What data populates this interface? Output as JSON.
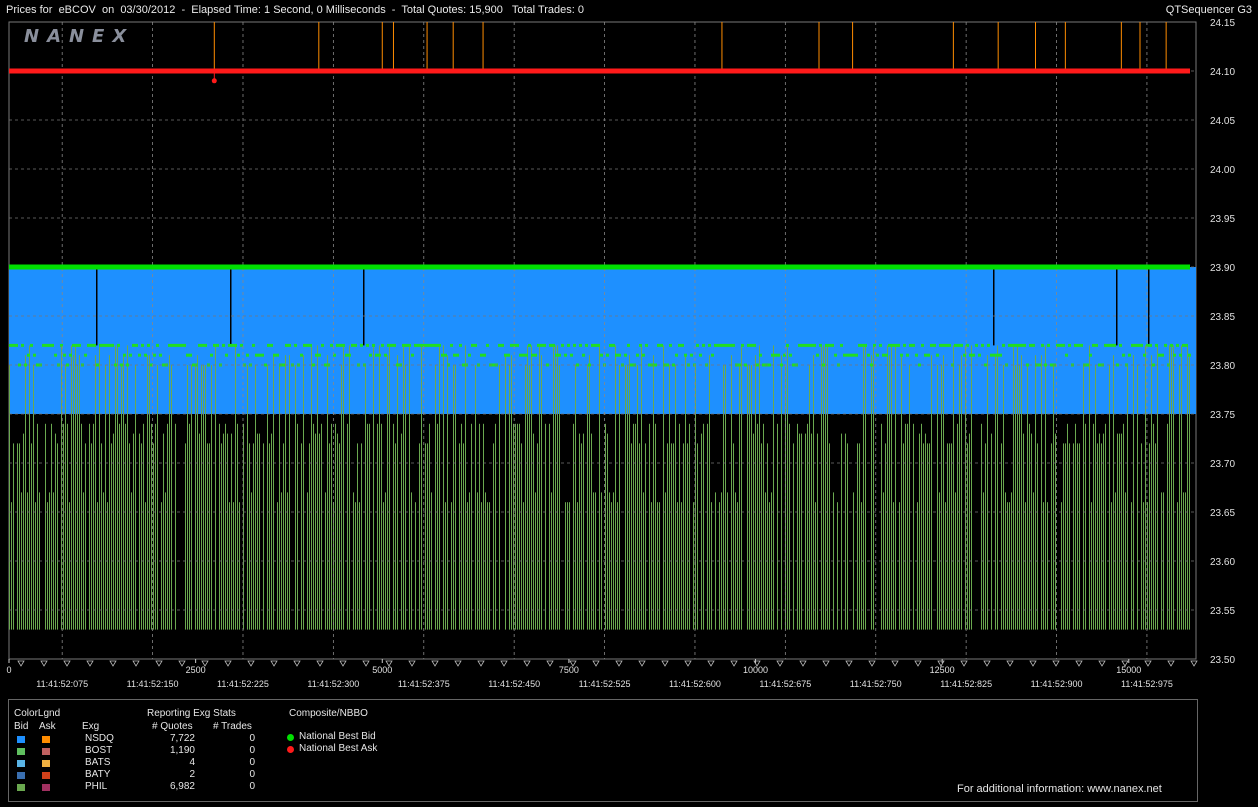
{
  "header": {
    "left_text": "Prices for  eBCOV  on  03/30/2012  -  Elapsed Time: 1 Second, 0 Milliseconds  -  Total Quotes: 15,900   Total Trades: 0",
    "right_text": "QTSequencer G3"
  },
  "logo_text": "NANEX",
  "chart_data": {
    "type": "line",
    "title": "",
    "ylim": [
      23.5,
      24.15
    ],
    "y_ticks": [
      "24.15",
      "24.10",
      "24.05",
      "24.00",
      "23.95",
      "23.90",
      "23.85",
      "23.80",
      "23.75",
      "23.70",
      "23.65",
      "23.60",
      "23.55",
      "23.50"
    ],
    "x_ticks_sequence": [
      {
        "label": "0",
        "x": 0
      },
      {
        "label": "2500",
        "x": 2500
      },
      {
        "label": "5000",
        "x": 5000
      },
      {
        "label": "7500",
        "x": 7500
      },
      {
        "label": "10000",
        "x": 10000
      },
      {
        "label": "12500",
        "x": 12500
      },
      {
        "label": "15000",
        "x": 15000
      }
    ],
    "x_ticks_time": [
      "11:41:52:075",
      "11:41:52:150",
      "11:41:52:225",
      "11:41:52:300",
      "11:41:52:375",
      "11:41:52:450",
      "11:41:52:525",
      "11:41:52:600",
      "11:41:52:675",
      "11:41:52:750",
      "11:41:52:825",
      "11:41:52:900",
      "11:41:52:975"
    ],
    "xlim": [
      0,
      15900
    ],
    "grid": true,
    "series": [
      {
        "name": "National Best Bid",
        "color": "#00e000",
        "values_description_price": 23.9
      },
      {
        "name": "National Best Ask",
        "color": "#ff1a1a",
        "values_description_price": 24.1
      }
    ],
    "nbb_price": 23.9,
    "nbo_price": 24.1,
    "nsdq_bid_top": 23.9,
    "nsdq_bid_bottom": 23.75,
    "phil_bid_level_high": 23.82,
    "phil_bid_level_low": 23.53,
    "ask_spike_positions": [
      2750,
      4150,
      5000,
      5150,
      5600,
      5950,
      6350,
      9550,
      10850,
      11300,
      12650,
      13250,
      13750,
      14150,
      14900,
      15150,
      15500
    ],
    "nbo_dip_point": {
      "x": 2750,
      "y": 24.09
    }
  },
  "legend": {
    "color_legend_title": "ColorLgnd",
    "reporting_title": "Reporting Exg Stats",
    "composite_title": "Composite/NBBO",
    "col_bid": "Bid",
    "col_ask": "Ask",
    "col_exg": "Exg",
    "col_quotes": "# Quotes",
    "col_trades": "# Trades",
    "rows": [
      {
        "exg": "NSDQ",
        "quotes": "7,722",
        "trades": "0",
        "bid_color": "#1e90ff",
        "ask_color": "#ff8c00"
      },
      {
        "exg": "BOST",
        "quotes": "1,190",
        "trades": "0",
        "bid_color": "#5fbf5f",
        "ask_color": "#c06060"
      },
      {
        "exg": "BATS",
        "quotes": "4",
        "trades": "0",
        "bid_color": "#5ab4e6",
        "ask_color": "#f0b040"
      },
      {
        "exg": "BATY",
        "quotes": "2",
        "trades": "0",
        "bid_color": "#3a6fb0",
        "ask_color": "#d0401a"
      },
      {
        "exg": "PHIL",
        "quotes": "6,982",
        "trades": "0",
        "bid_color": "#6aa84f",
        "ask_color": "#a03060"
      }
    ],
    "nbb_label": "National Best Bid",
    "nbo_label": "National Best Ask",
    "nbb_color": "#00e000",
    "nbo_color": "#ff1a1a",
    "footer": "For additional information: www.nanex.net"
  }
}
